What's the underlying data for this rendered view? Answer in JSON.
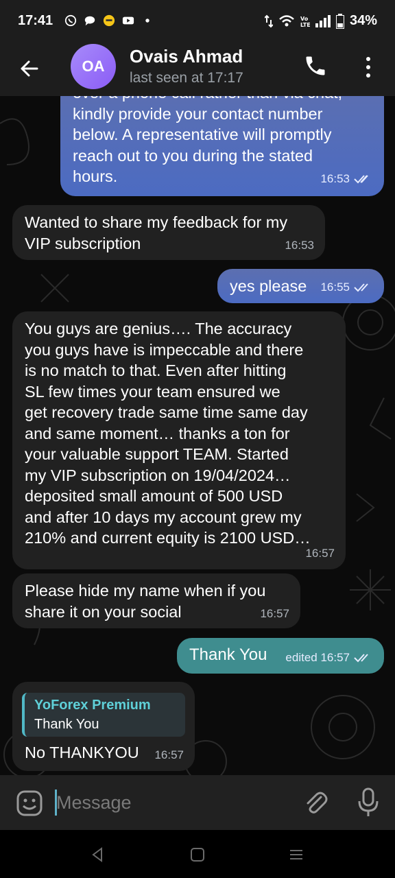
{
  "status_bar": {
    "time": "17:41",
    "battery": "34%",
    "icons": [
      "whatsapp-icon",
      "chat-icon",
      "emoji-icon",
      "youtube-icon",
      "dot-icon",
      "data-arrows-icon",
      "wifi-icon",
      "volte-icon",
      "signal-icon",
      "battery-icon"
    ]
  },
  "header": {
    "avatar_initials": "OA",
    "contact_name": "Ovais Ahmad",
    "last_seen": "last seen at 17:17",
    "avatar_color": "#8b5cf6"
  },
  "messages": [
    {
      "direction": "out",
      "text": "over a phone call rather than via chat,\nkindly provide your contact number\nbelow. A representative will promptly\nreach out to you during the stated\nhours.",
      "time": "16:53",
      "read": true
    },
    {
      "direction": "in",
      "text": "Wanted to share my feedback for my\nVIP subscription",
      "time": "16:53"
    },
    {
      "direction": "out",
      "text": "yes please",
      "time": "16:55",
      "read": true
    },
    {
      "direction": "in",
      "text": "You guys are genius…. The accuracy\nyou guys have is impeccable and there\nis no match to that. Even after hitting\nSL few times your team ensured we\nget recovery trade same time same day\nand same moment… thanks a ton for\nyour valuable support TEAM. Started\nmy VIP subscription on 19/04/2024…\ndeposited small amount of 500 USD\nand after 10 days my account grew my\n210% and current equity is 2100 USD…",
      "time": "16:57"
    },
    {
      "direction": "in",
      "text": "Please hide my name when if you\nshare it on your social",
      "time": "16:57"
    },
    {
      "direction": "out",
      "text": "Thank You",
      "time": "edited 16:57",
      "read": true
    },
    {
      "direction": "in",
      "reply_to": {
        "sender": "YoForex Premium",
        "text": "Thank You"
      },
      "text": "No THANKYOU",
      "time": "16:57"
    }
  ],
  "input": {
    "placeholder": "Message"
  },
  "colors": {
    "outgoing_bubble": "#5468b8",
    "outgoing_bubble_teal": "#3f8d8f",
    "incoming_bubble": "#212121",
    "accent": "#5fd0d8"
  }
}
